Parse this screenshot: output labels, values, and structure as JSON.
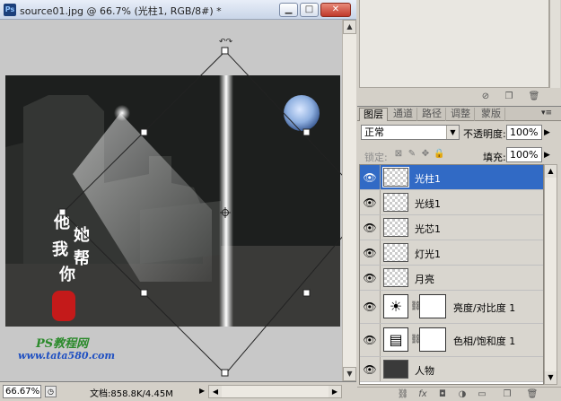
{
  "document": {
    "title": "source01.jpg @ 66.7% (光柱1, RGB/8#) *",
    "app_badge": "Ps",
    "zoom": "66.67%",
    "doc_info": "文档:858.8K/4.45M",
    "window_controls": {
      "minimize": "▁",
      "maximize": "□",
      "close": "✕"
    },
    "artwork": {
      "calligraphy_chars": [
        "他",
        "她",
        "我",
        "帮",
        "你"
      ],
      "watermark_line1": "PS教程网",
      "watermark_line2": "www.tata580.com"
    }
  },
  "layers_panel": {
    "tabs": [
      {
        "label": "图层",
        "active": true
      },
      {
        "label": "通道",
        "active": false
      },
      {
        "label": "路径",
        "active": false
      },
      {
        "label": "调整",
        "active": false
      },
      {
        "label": "蒙版",
        "active": false
      }
    ],
    "blend_mode": "正常",
    "opacity_label": "不透明度:",
    "opacity_value": "100%",
    "lock_label": "锁定:",
    "fill_label": "填充:",
    "fill_value": "100%",
    "layers": [
      {
        "name": "光柱1",
        "selected": true,
        "kind": "pixel"
      },
      {
        "name": "光线1",
        "selected": false,
        "kind": "pixel"
      },
      {
        "name": "光芯1",
        "selected": false,
        "kind": "pixel"
      },
      {
        "name": "灯光1",
        "selected": false,
        "kind": "pixel"
      },
      {
        "name": "月亮",
        "selected": false,
        "kind": "pixel"
      },
      {
        "name": "亮度/对比度 1",
        "selected": false,
        "kind": "adjustment",
        "icon": "sun-icon"
      },
      {
        "name": "色相/饱和度 1",
        "selected": false,
        "kind": "adjustment",
        "icon": "hue-saturation-icon"
      },
      {
        "name": "人物",
        "selected": false,
        "kind": "pixel"
      }
    ]
  },
  "colors": {
    "selection_blue": "#316ac5",
    "panel_gray": "#d4d0c8",
    "seal_red": "#c41a1a",
    "watermark_green": "#2b8a2b",
    "watermark_blue": "#1e4fc2"
  }
}
